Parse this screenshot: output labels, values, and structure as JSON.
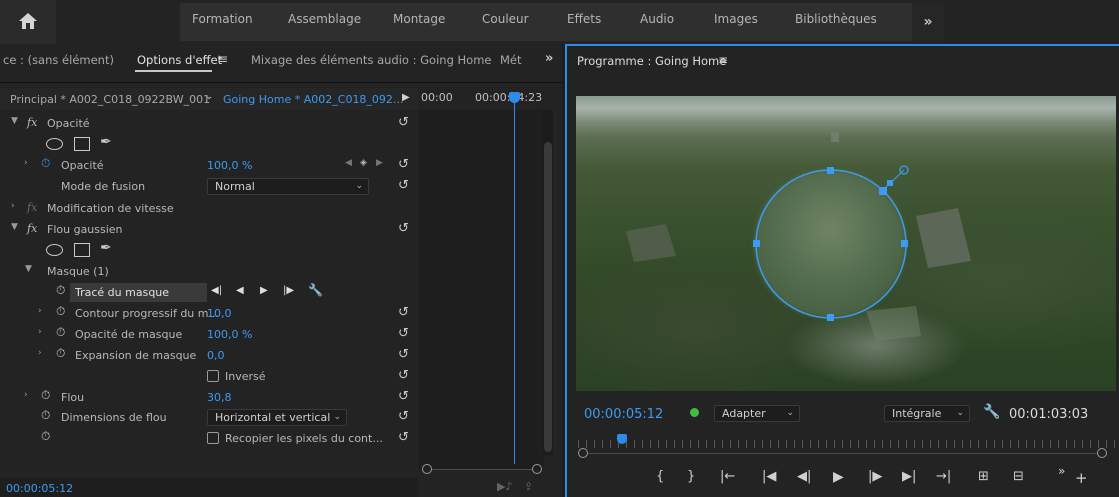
{
  "workspaces": {
    "items": [
      "Formation",
      "Assemblage",
      "Montage",
      "Couleur",
      "Effets",
      "Audio",
      "Images",
      "Bibliothèques"
    ],
    "more": "»"
  },
  "left_panel": {
    "tabs": {
      "source": "ce : (sans élément)",
      "effect_controls": "Options d'effet",
      "audio_mixer": "Mixage des éléments audio : Going Home",
      "metadata": "Mét"
    },
    "overflow": "»",
    "sequence": {
      "master_clip": "Principal * A002_C018_0922BW_001",
      "sequence_clip": "Going Home * A002_C018_092..."
    },
    "ruler": {
      "start": "00:00",
      "end": "00:00:04:23"
    },
    "effects": {
      "opacity_section": "Opacité",
      "opacity_label": "Opacité",
      "opacity_value": "100,0 %",
      "blend_mode_label": "Mode de fusion",
      "blend_mode_value": "Normal",
      "speed_section": "Modification de vitesse",
      "blur_section": "Flou gaussien",
      "mask_label": "Masque (1)",
      "mask_path_label": "Tracé du masque",
      "mask_feather_label": "Contour progressif du m...",
      "mask_feather_value": "10,0",
      "mask_opacity_label": "Opacité de masque",
      "mask_opacity_value": "100,0 %",
      "mask_expansion_label": "Expansion de masque",
      "mask_expansion_value": "0,0",
      "inverted_label": "Inversé",
      "blurriness_label": "Flou",
      "blurriness_value": "30,8",
      "blur_dimensions_label": "Dimensions de flou",
      "blur_dimensions_value": "Horizontal et vertical",
      "repeat_edge_label": "Recopier les pixels du cont..."
    },
    "timecode": "00:00:05:12"
  },
  "program_monitor": {
    "title": "Programme : Going Home",
    "current_time": "00:00:05:12",
    "fit": "Adapter",
    "resolution": "Intégrale",
    "duration": "00:01:03:03"
  },
  "colors": {
    "accent": "#2d8ceb",
    "value_blue": "#3c9bf2",
    "status_green": "#3fbf3f"
  }
}
